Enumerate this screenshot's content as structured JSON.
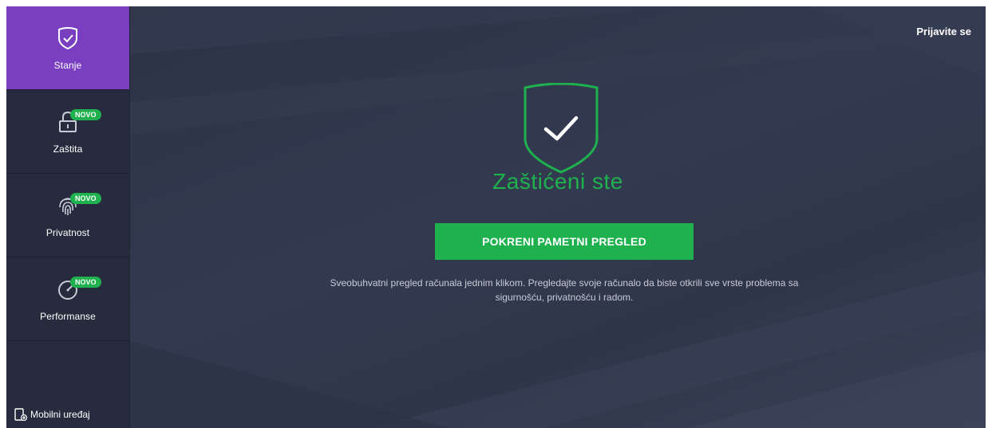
{
  "sidebar": {
    "items": [
      {
        "label": "Stanje",
        "icon": "shield-check-icon",
        "active": true,
        "badge": ""
      },
      {
        "label": "Zaštita",
        "icon": "lock-icon",
        "active": false,
        "badge": "NOVO"
      },
      {
        "label": "Privatnost",
        "icon": "fingerprint-icon",
        "active": false,
        "badge": "NOVO"
      },
      {
        "label": "Performanse",
        "icon": "speedometer-icon",
        "active": false,
        "badge": "NOVO"
      }
    ],
    "mobile_label": "Mobilni uređaj",
    "mobile_icon": "mobile-device-icon"
  },
  "header": {
    "signin_label": "Prijavite se"
  },
  "main": {
    "status_icon": "shield-check-icon",
    "status_text": "Zaštićeni ste",
    "scan_button_label": "POKRENI PAMETNI PREGLED",
    "description": "Sveobuhvatni pregled računala jednim klikom. Pregledajte svoje računalo da biste otkrili sve vrste problema sa sigurnošću, privatnošću i radom."
  },
  "colors": {
    "accent_purple": "#7a3fc0",
    "success_green": "#1fb14e",
    "sidebar_bg": "#262c3d",
    "main_bg": "#2f3547"
  }
}
